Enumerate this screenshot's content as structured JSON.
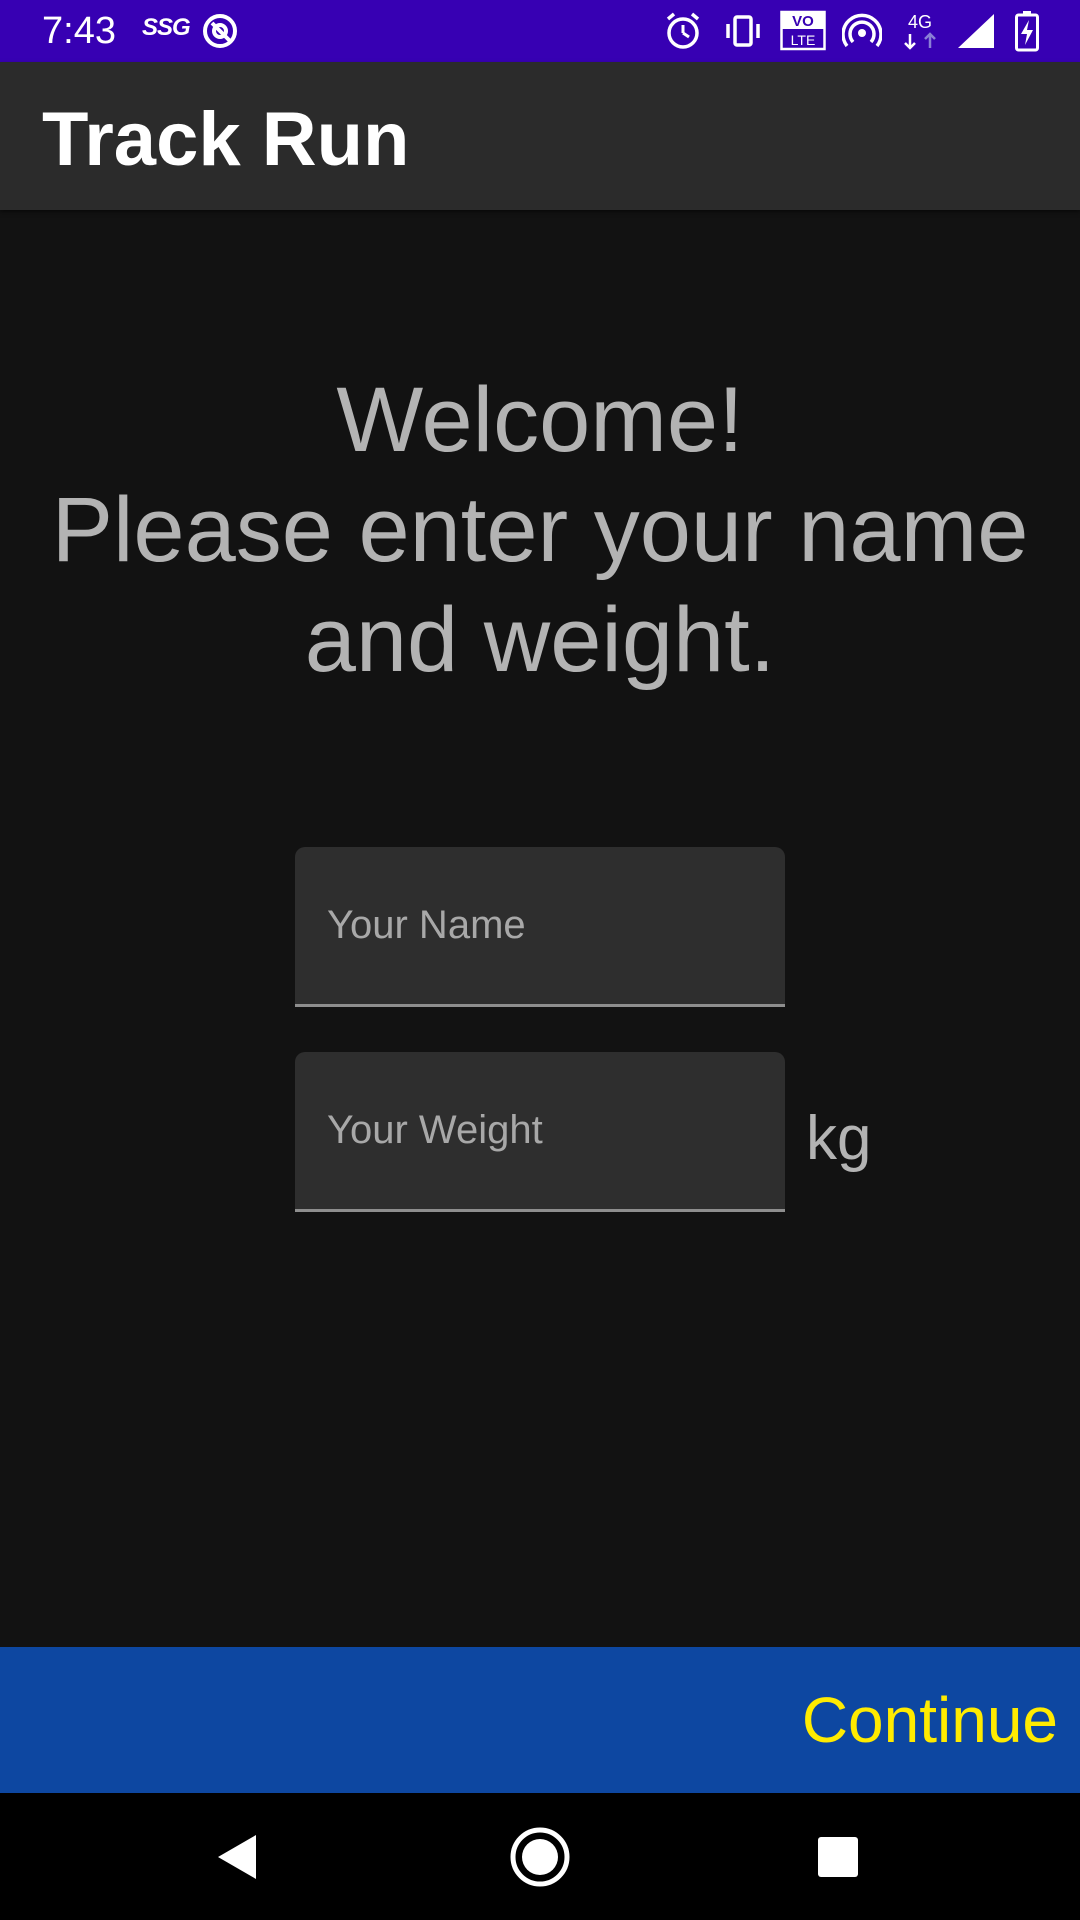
{
  "status_bar": {
    "time": "7:43",
    "carrier": "SSG",
    "icons": [
      "at-sign-icon",
      "alarm-icon",
      "vibrate-icon",
      "volte-icon",
      "hotspot-icon",
      "4g-icon",
      "signal-icon",
      "battery-charging-icon"
    ],
    "volte_top": "VO",
    "volte_bottom": "LTE",
    "network": "4G",
    "background": "#3700b3"
  },
  "app_bar": {
    "title": "Track Run",
    "background": "#2b2b2b"
  },
  "welcome": {
    "line1": "Welcome!",
    "line2": "Please enter your name",
    "line3": "and weight."
  },
  "form": {
    "name": {
      "value": "",
      "placeholder": "Your Name"
    },
    "weight": {
      "value": "",
      "placeholder": "Your Weight",
      "unit": "kg"
    }
  },
  "continue": {
    "label": "Continue",
    "background": "#0d47a1",
    "text_color": "#ffeb00"
  },
  "nav_bar": {
    "buttons": [
      "back-icon",
      "home-icon",
      "recents-icon"
    ]
  }
}
